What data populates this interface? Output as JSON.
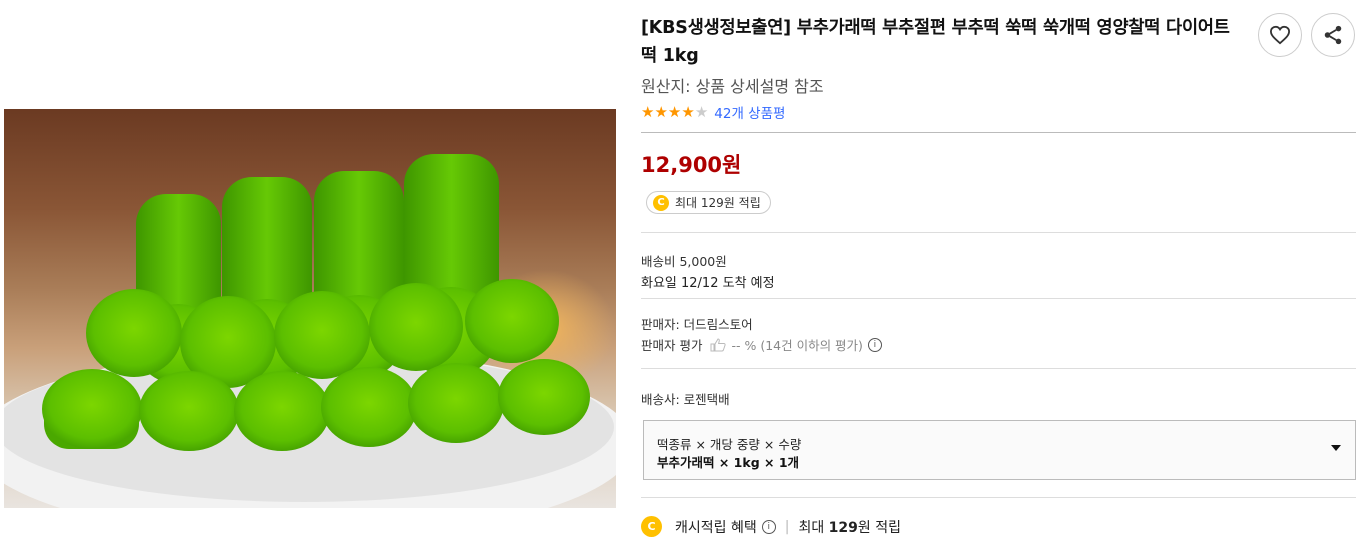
{
  "product": {
    "title": "[KBS생생정보출연] 부추가래떡 부추절편 부추떡 쑥떡 쑥개떡 영양찰떡 다이어트떡 1kg",
    "origin": "원산지: 상품 상세설명 참조",
    "rating_value": 4,
    "rating_max": 5,
    "review_count": "42개 상품평",
    "price": "12,900원",
    "reward_badge": "최대 129원 적립",
    "coin_glyph": "C"
  },
  "shipping": {
    "fee": "배송비 5,000원",
    "arrival": "화요일 12/12 도착 예정"
  },
  "seller": {
    "name": "판매자: 더드림스토어",
    "rating_label": "판매자 평가",
    "rating_value": "-- % (14건 이하의 평가)",
    "courier": "배송사: 로젠택배"
  },
  "option": {
    "label": "떡종류 × 개당 중량 × 수량",
    "value": "부추가래떡 × 1kg × 1개"
  },
  "cash_benefit": {
    "label": "캐시적립 혜택",
    "value_prefix": "최대 ",
    "value_amount": "129",
    "value_suffix": "원 적립"
  },
  "colors": {
    "price": "#ae0000",
    "link": "#346aff",
    "star": "#ff9600",
    "coin": "#ffc000"
  },
  "icons": {
    "wishlist": "heart-icon",
    "share": "share-icon",
    "info": "info-icon",
    "thumb": "thumb-icon"
  }
}
